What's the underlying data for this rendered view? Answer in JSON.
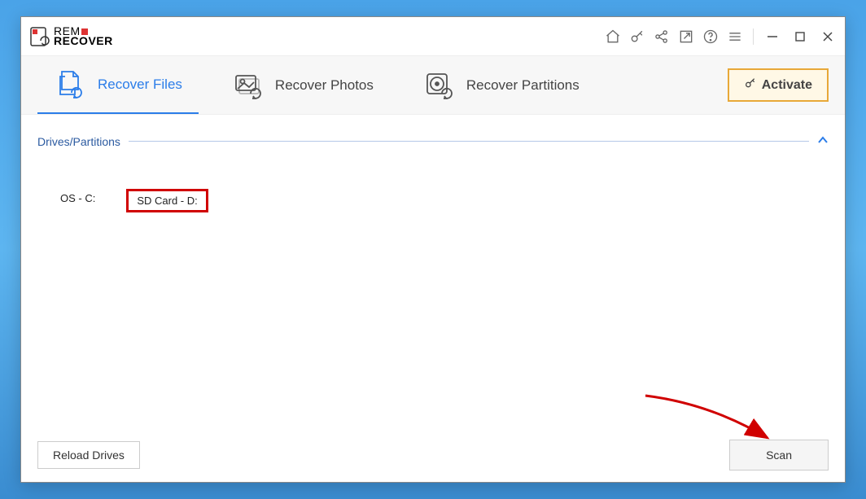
{
  "logo": {
    "line1": "rem",
    "line2": "RECOVER"
  },
  "tabs": [
    {
      "label": "Recover Files",
      "active": true
    },
    {
      "label": "Recover Photos",
      "active": false
    },
    {
      "label": "Recover Partitions",
      "active": false
    }
  ],
  "activate": {
    "label": "Activate"
  },
  "section": {
    "title": "Drives/Partitions"
  },
  "drives": [
    {
      "label": "OS - C:",
      "highlighted": false
    },
    {
      "label": "SD Card - D:",
      "highlighted": true
    }
  ],
  "buttons": {
    "reload": "Reload Drives",
    "scan": "Scan"
  }
}
